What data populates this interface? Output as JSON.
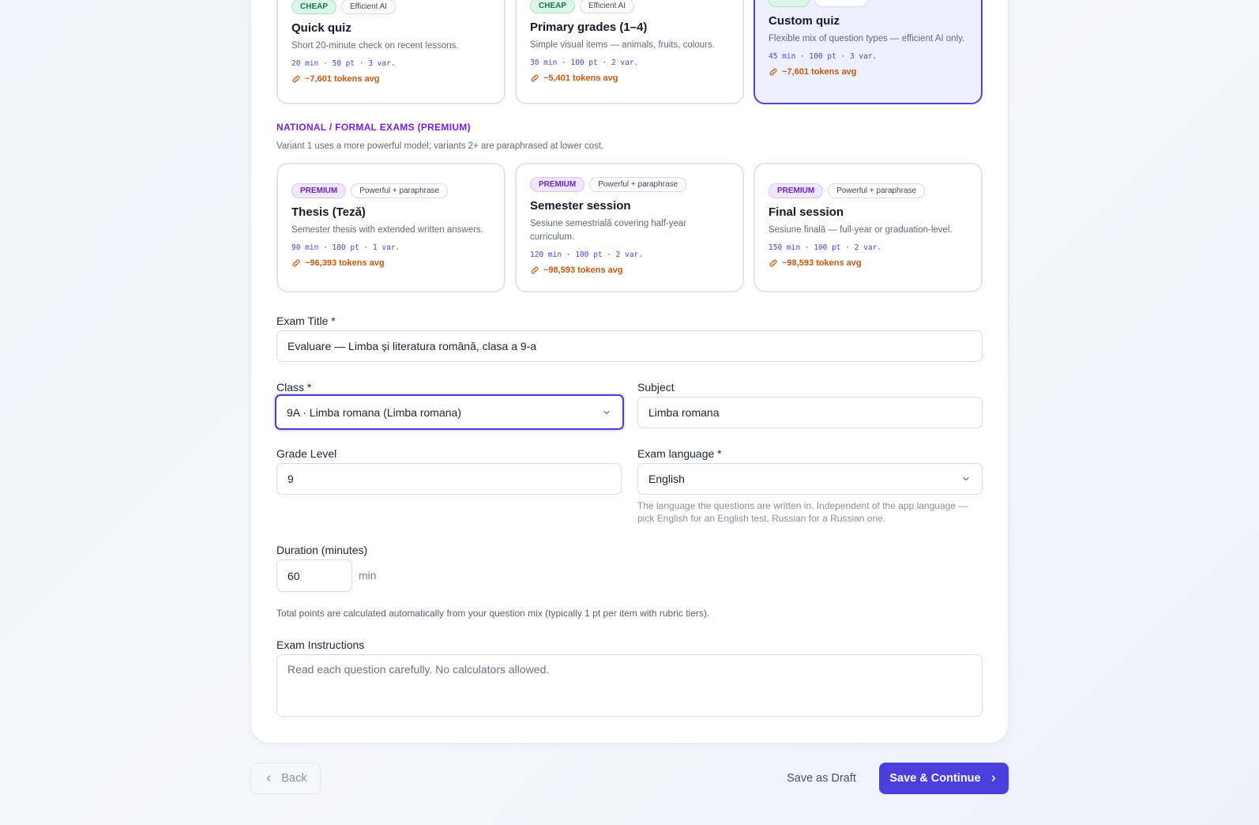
{
  "quick_tiles": [
    {
      "badge": "CHEAP",
      "mode": "Efficient AI",
      "title": "Quick quiz",
      "desc": "Short 20-minute check on recent lessons.",
      "meta": "20 min · 50 pt · 3 var.",
      "tokens": "~7,601 tokens avg"
    },
    {
      "badge": "CHEAP",
      "mode": "Efficient AI",
      "title": "Primary grades (1–4)",
      "desc": "Simple visual items — animals, fruits, colours.",
      "meta": "30 min · 100 pt · 2 var.",
      "tokens": "~5,401 tokens avg"
    },
    {
      "title": "Custom quiz",
      "desc": "Flexible mix of question types — efficient AI only.",
      "meta": "45 min · 100 pt · 3 var.",
      "tokens": "~7,601 tokens avg"
    }
  ],
  "formal_section": {
    "title": "NATIONAL / FORMAL EXAMS (PREMIUM)",
    "subtitle": "Variant 1 uses a more powerful model; variants 2+ are paraphrased at lower cost."
  },
  "formal_tiles": [
    {
      "badge": "PREMIUM",
      "mode": "Powerful + paraphrase",
      "title": "Thesis (Teză)",
      "desc": "Semester thesis with extended written answers.",
      "meta": "90 min · 100 pt · 1 var.",
      "tokens": "~96,393 tokens avg"
    },
    {
      "badge": "PREMIUM",
      "mode": "Powerful + paraphrase",
      "title": "Semester session",
      "desc": "Sesiune semestrială covering half-year curriculum.",
      "meta": "120 min · 100 pt · 2 var.",
      "tokens": "~98,593 tokens avg"
    },
    {
      "badge": "PREMIUM",
      "mode": "Powerful + paraphrase",
      "title": "Final session",
      "desc": "Sesiune finală — full-year or graduation-level.",
      "meta": "150 min · 100 pt · 2 var.",
      "tokens": "~98,593 tokens avg"
    }
  ],
  "form": {
    "exam_title_label": "Exam Title *",
    "exam_title_value": "Evaluare — Limba și literatura română, clasa a 9-a",
    "class_label": "Class *",
    "class_value": "9A · Limba romana (Limba romana)",
    "subject_label": "Subject",
    "subject_value": "Limba romana",
    "grade_label": "Grade Level",
    "grade_value": "9",
    "language_label": "Exam language *",
    "language_value": "English",
    "language_hint": "The language the questions are written in. Independent of the app language — pick English for an English test, Russian for a Russian one.",
    "duration_label": "Duration (minutes)",
    "duration_value": "60",
    "duration_unit": "min",
    "points_note": "Total points are calculated automatically from your question mix (typically 1 pt per item with rubric tiers).",
    "instructions_label": "Exam Instructions",
    "instructions_value": "Read each question carefully. No calculators allowed."
  },
  "footer": {
    "back_label": "Back",
    "draft_label": "Save as Draft",
    "save_label": "Save & Continue"
  },
  "colors": {
    "accent": "#4a3fdc",
    "premium": "#7a22d6",
    "cheap": "#16794d",
    "tokens": "#c35a12"
  }
}
